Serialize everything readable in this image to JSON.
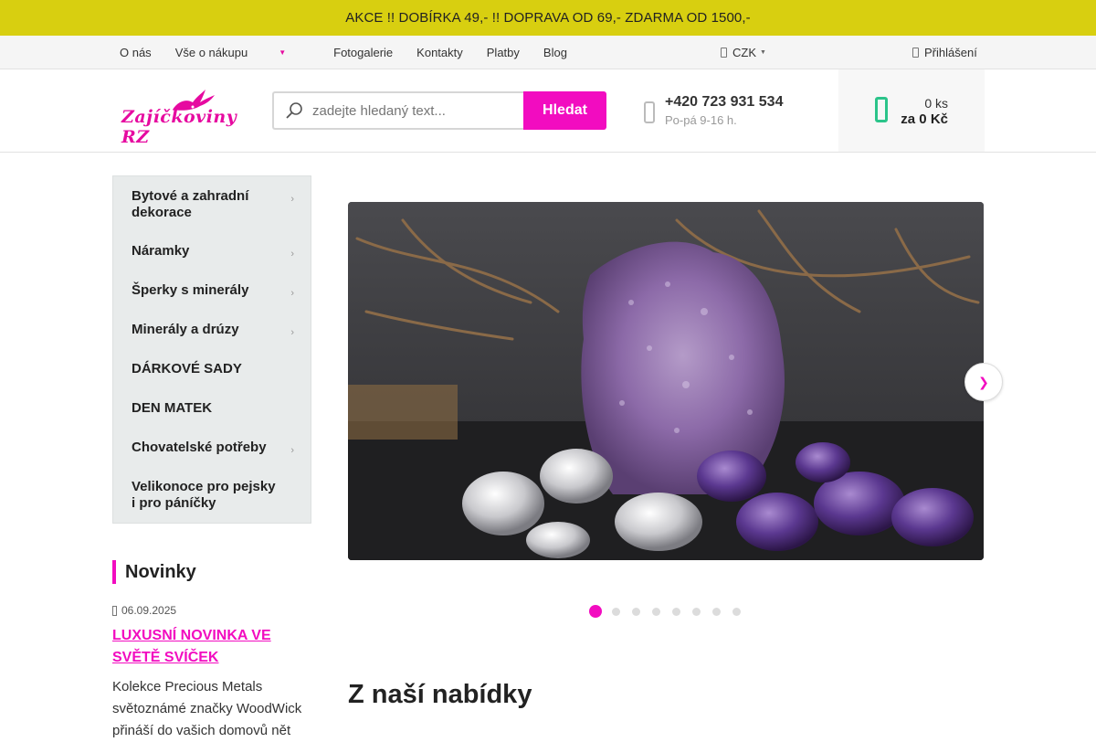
{
  "promo": {
    "text": "AKCE !! DOBÍRKA 49,- !! DOPRAVA OD 69,- ZDARMA OD 1500,-"
  },
  "topnav": {
    "links": [
      "O nás",
      "Vše o nákupu",
      "Fotogalerie",
      "Kontakty",
      "Platby",
      "Blog"
    ],
    "currency": "CZK",
    "login": "Přihlášení"
  },
  "header": {
    "logo_text": "Zajíčkoviny RZ",
    "search_placeholder": "zadejte hledaný text...",
    "search_button": "Hledat",
    "phone": "+420 723 931 534",
    "hours": "Po-pá 9-16 h.",
    "cart_count": "0 ks",
    "cart_sum": "za 0 Kč"
  },
  "sidebar": {
    "categories": [
      {
        "label_line1": "Bytové a zahradní",
        "label_line2": "dekorace",
        "has_sub": true
      },
      {
        "label_line1": "Náramky",
        "has_sub": true
      },
      {
        "label_line1": "Šperky s minerály",
        "has_sub": true
      },
      {
        "label_line1": "Minerály a drúzy",
        "has_sub": true
      },
      {
        "label_line1": "DÁRKOVÉ SADY",
        "has_sub": false
      },
      {
        "label_line1": "DEN MATEK",
        "has_sub": false
      },
      {
        "label_line1": "Chovatelské potřeby",
        "has_sub": true
      },
      {
        "label_line1": "Velikonoce pro pejsky",
        "label_line2": "i pro páníčky",
        "has_sub": false
      }
    ]
  },
  "news": {
    "heading": "Novinky",
    "date": "06.09.2025",
    "title_line1": "LUXUSNÍ NOVINKA VE",
    "title_line2": "SVĚTĚ SVÍČEK",
    "text_line1": "Kolekce Precious Metals",
    "text_line2": "světoznámé značky WoodWick",
    "text_line3": "přináší do vašich domovů nět"
  },
  "slider": {
    "slide_count": 8,
    "active_index": 0
  },
  "main": {
    "offer_heading": "Z naší nabídky"
  },
  "colors": {
    "accent": "#f20cc0",
    "promo_bg": "#d8cf10",
    "cart_icon": "#2bc48a"
  }
}
